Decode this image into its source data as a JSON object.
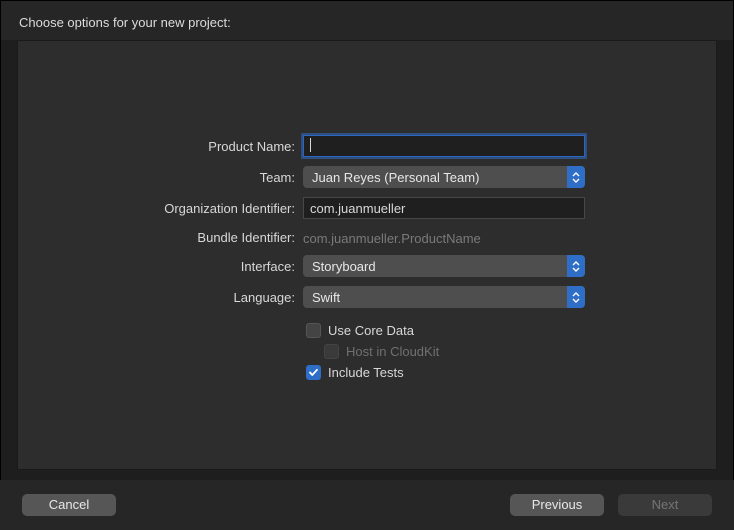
{
  "header": {
    "title": "Choose options for your new project:"
  },
  "form": {
    "productName": {
      "label": "Product Name:",
      "value": ""
    },
    "team": {
      "label": "Team:",
      "value": "Juan Reyes (Personal Team)"
    },
    "orgIdentifier": {
      "label": "Organization Identifier:",
      "value": "com.juanmueller"
    },
    "bundleIdentifier": {
      "label": "Bundle Identifier:",
      "value": "com.juanmueller.ProductName"
    },
    "interface": {
      "label": "Interface:",
      "value": "Storyboard"
    },
    "language": {
      "label": "Language:",
      "value": "Swift"
    },
    "useCoreData": {
      "label": "Use Core Data",
      "checked": false
    },
    "hostCloudKit": {
      "label": "Host in CloudKit",
      "checked": false,
      "disabled": true
    },
    "includeTests": {
      "label": "Include Tests",
      "checked": true
    }
  },
  "footer": {
    "cancel": "Cancel",
    "previous": "Previous",
    "next": "Next"
  }
}
